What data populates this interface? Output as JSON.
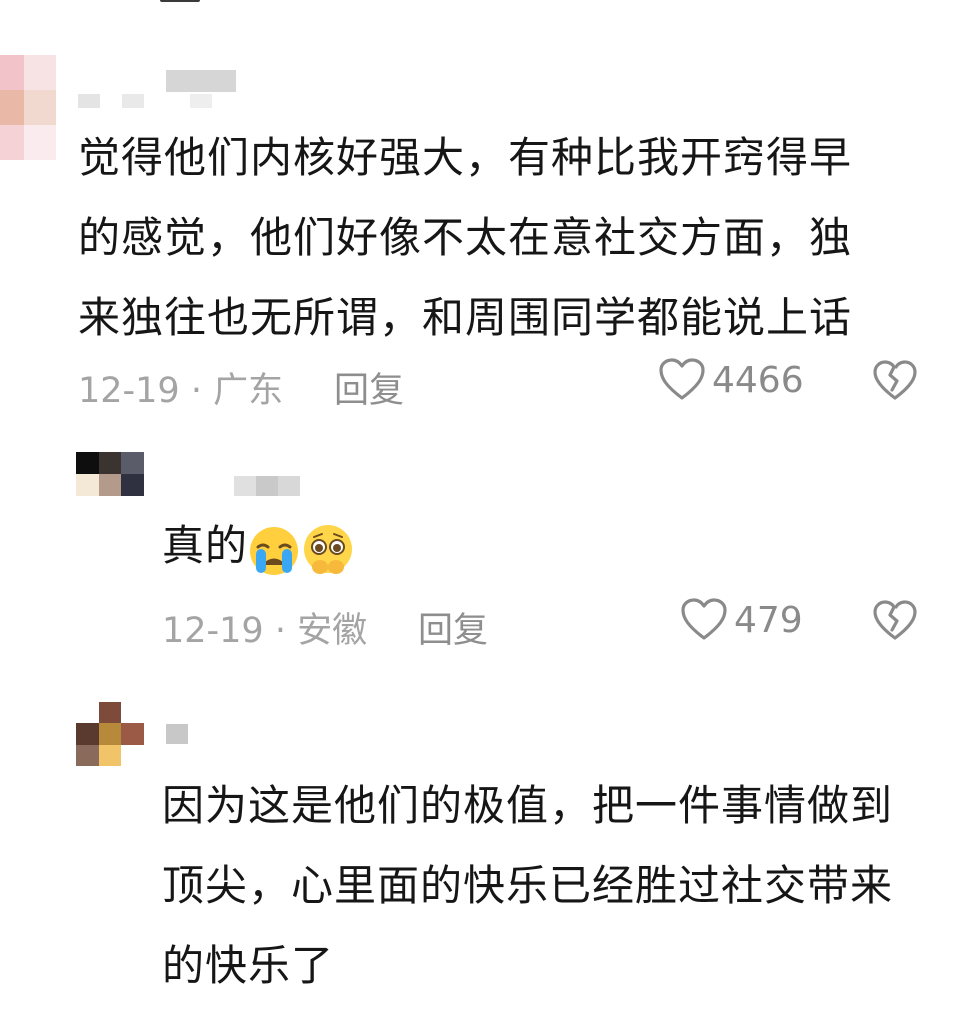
{
  "comments": [
    {
      "text_lines": [
        "觉得他们内核好强大，有种比我开窍得早",
        "的感觉，他们好像不太在意社交方面，独",
        "来独往也无所谓，和周围同学都能说上话"
      ],
      "date_location": "12-19 · 广东",
      "reply_label": "回复",
      "likes": "4466"
    },
    {
      "text": "真的",
      "emojis": [
        "crying-face-emoji",
        "pleading-face-emoji"
      ],
      "date_location": "12-19 · 安徽",
      "reply_label": "回复",
      "likes": "479"
    },
    {
      "text_lines": [
        "因为这是他们的极值，把一件事情做到",
        "顶尖，心里面的快乐已经胜过社交带来",
        "的快乐了"
      ]
    }
  ]
}
